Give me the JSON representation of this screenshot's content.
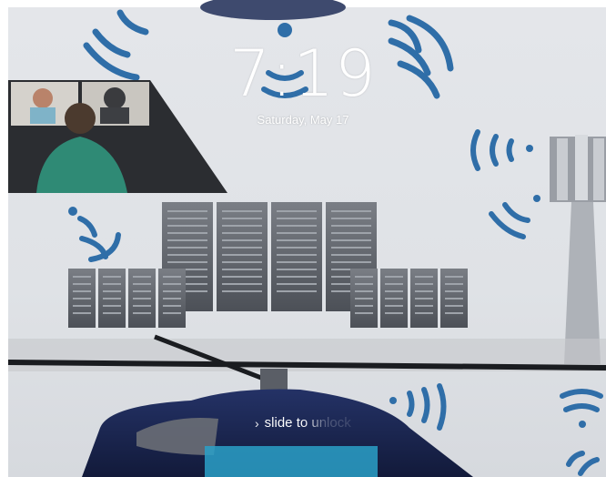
{
  "lock_screen": {
    "time": "7:19",
    "date": "Saturday, May 17",
    "unlock_chevron": "›",
    "unlock_text": "slide to unlock"
  },
  "wallpaper": {
    "signal_color": "#2f6ea8",
    "server_color": "#5b5f66",
    "helicopter_color": "#1e2a55"
  }
}
